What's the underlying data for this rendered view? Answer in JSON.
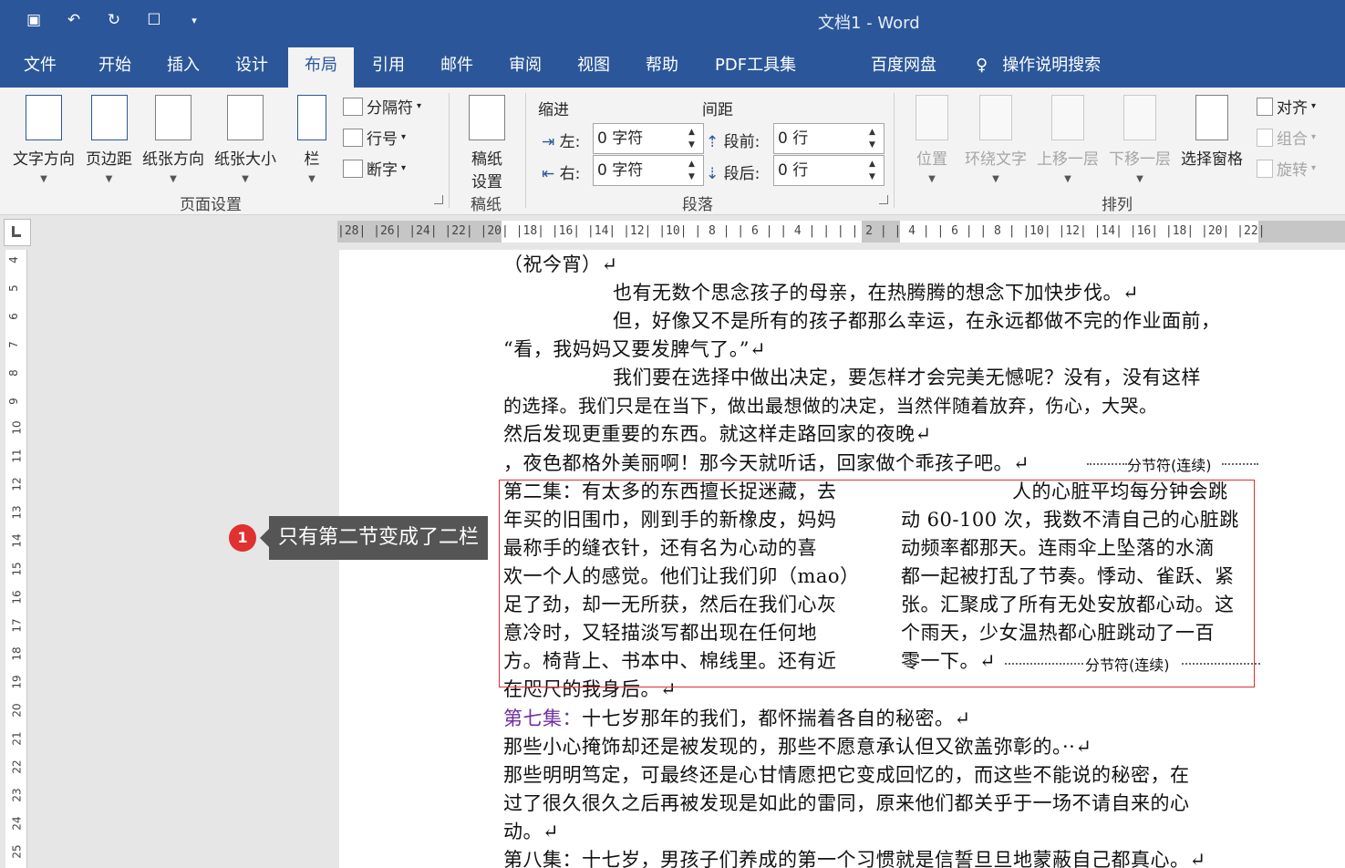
{
  "window": {
    "title": "文档1  -  Word"
  },
  "qat": {
    "icons": [
      "save-icon",
      "undo-icon",
      "redo-icon",
      "touch-mode-icon",
      "customize-icon"
    ]
  },
  "tabs": [
    "文件",
    "开始",
    "插入",
    "设计",
    "布局",
    "引用",
    "邮件",
    "审阅",
    "视图",
    "帮助",
    "PDF工具集",
    "百度网盘",
    "操作说明搜索"
  ],
  "active_tab": "布局",
  "ribbon": {
    "page_setup": {
      "text_direction": "文字方向",
      "margins": "页边距",
      "orientation": "纸张方向",
      "size": "纸张大小",
      "columns": "栏",
      "breaks": "分隔符",
      "line_numbers": "行号",
      "hyphenation": "断字",
      "label": "页面设置"
    },
    "draft": {
      "button": "稿纸\n设置",
      "btn_l1": "稿纸",
      "btn_l2": "设置",
      "label": "稿纸"
    },
    "paragraph": {
      "indent_title": "缩进",
      "spacing_title": "间距",
      "left_label": "左:",
      "left_value": "0 字符",
      "right_label": "右:",
      "right_value": "0 字符",
      "before_label": "段前:",
      "before_value": "0 行",
      "after_label": "段后:",
      "after_value": "0 行",
      "label": "段落"
    },
    "arrange": {
      "position": "位置",
      "wrap_text": "环绕文字",
      "bring_forward": "上移一层",
      "send_backward": "下移一层",
      "selection_pane": "选择窗格",
      "align": "对齐",
      "group": "组合",
      "rotate": "旋转",
      "label": "排列"
    }
  },
  "ruler": {
    "ticks": "|28|  |26|  |24|  |22|  |20|  |18|  |16|  |14|  |12|  |10|  | 8 |  | 6 |  | 4 |  |       |  | 2 |  | 4 |  | 6 |  | 8 |  |10|  |12|  |14|  |16|  |18|  |20|  |22|",
    "vertical": [
      "4",
      "5",
      "6",
      "7",
      "8",
      "9",
      "10",
      "11",
      "12",
      "13",
      "14",
      "15",
      "16",
      "17",
      "18",
      "19",
      "20",
      "21",
      "22",
      "23",
      "24",
      "25"
    ]
  },
  "document": {
    "lines": [
      "（祝今宵）↵",
      "也有无数个思念孩子的母亲，在热腾腾的想念下加快步伐。↵",
      "但，好像又不是所有的孩子都那么幸运，在永远都做不完的作业面前，",
      "“看，我妈妈又要发脾气了。”↵",
      "我们要在选择中做出决定，要怎样才会完美无憾呢？没有，没有这样",
      "的选择。我们只是在当下，做出最想做的决定，当然伴随着放弃，伤心，大哭。",
      "然后发现更重要的东西。就这样走路回家的夜晚↵",
      "，夜色都格外美丽啊！那今天就听话，回家做个乖孩子吧。↵"
    ],
    "section_break_1": "分节符(连续)",
    "col_left": [
      "第二集：有太多的东西擅长捉迷藏，去",
      "年买的旧围巾，刚到手的新橡皮，妈妈",
      "最称手的缝衣针，还有名为心动的喜",
      "欢一个人的感觉。他们让我们卯（mao）",
      "足了劲，却一无所获，然后在我们心灰",
      "意冷时，又轻描淡写都出现在任何地",
      "方。椅背上、书本中、棉线里。还有近",
      "在咫尺的我身后。↵"
    ],
    "col_right": [
      "人的心脏平均每分钟会跳",
      "动 60-100 次，我数不清自己的心脏跳",
      "动频率都那天。连雨伞上坠落的水滴",
      "都一起被打乱了节奏。悸动、雀跃、紧",
      "张。汇聚成了所有无处安放都心动。这",
      "个雨天，少女温热都心脏跳动了一百",
      "零一下。↵"
    ],
    "section_break_2": "分节符(连续)",
    "after": {
      "l1_head": "第七集：",
      "l1_body": "十七岁那年的我们，都怀揣着各自的秘密。↵",
      "l2": "那些小心掩饰却还是被发现的，那些不愿意承认但又欲盖弥彰的。··↵",
      "l3": "那些明明笃定，可最终还是心甘情愿把它变成回忆的，而这些不能说的秘密，在",
      "l4": "过了很久很久之后再被发现是如此的雷同，原来他们都关乎于一场不请自来的心",
      "l5": "动。↵",
      "l6": "第八集：十七岁，男孩子们养成的第一个习惯就是信誓旦旦地蒙蔽自己都真心。↵"
    }
  },
  "callout": {
    "number": "1",
    "text": "只有第二节变成了二栏"
  },
  "colors": {
    "titlebar": "#2b579a",
    "callout_bg": "#555555",
    "callout_badge": "#e03030",
    "highlight_box": "#e03030",
    "purple_heading": "#7030a0"
  }
}
